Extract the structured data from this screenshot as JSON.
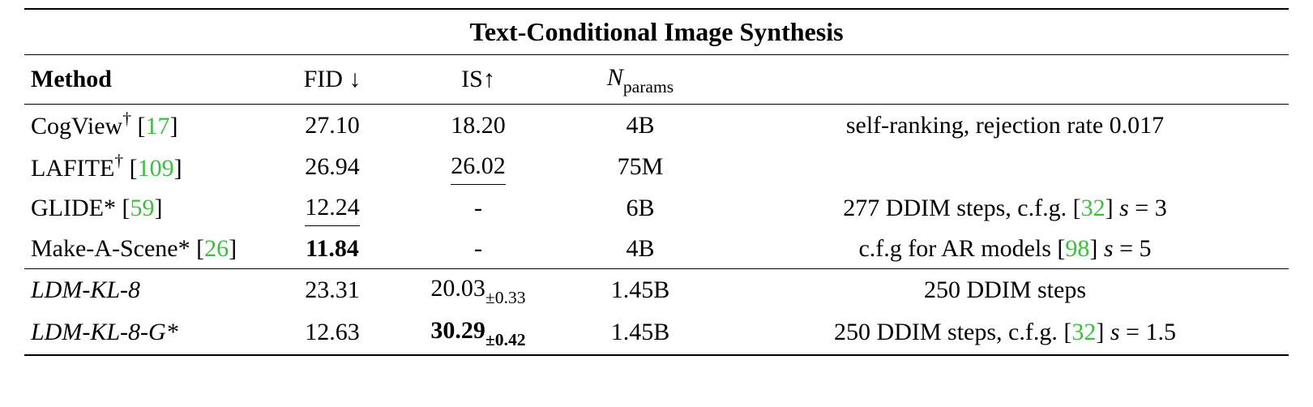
{
  "title": "Text-Conditional Image Synthesis",
  "headers": {
    "method": "Method",
    "fid_label": "FID",
    "fid_arrow": "↓",
    "is_label": "IS",
    "is_arrow": "↑",
    "nparams_symbol": "N",
    "nparams_sub": "params"
  },
  "rows": {
    "r0": {
      "method": "CogView",
      "method_marker": "†",
      "cite": "17",
      "fid": "27.10",
      "is": "18.20",
      "nparams": "4B",
      "note": "self-ranking, rejection rate 0.017"
    },
    "r1": {
      "method": "LAFITE",
      "method_marker": "†",
      "cite": "109",
      "fid": "26.94",
      "is": "26.02",
      "nparams": "75M",
      "note": ""
    },
    "r2": {
      "method": "GLIDE",
      "method_marker": "*",
      "cite": "59",
      "fid": "12.24",
      "is": "-",
      "nparams": "6B",
      "note_a": "277 DDIM steps, c.f.g. [",
      "note_cite": "32",
      "note_b": "] ",
      "note_s": "s",
      "note_eq": " = 3"
    },
    "r3": {
      "method": "Make-A-Scene",
      "method_marker": "*",
      "cite": "26",
      "fid": "11.84",
      "is": "-",
      "nparams": "4B",
      "note_a": "c.f.g for AR models [",
      "note_cite": "98",
      "note_b": "] ",
      "note_s": "s",
      "note_eq": " = 5"
    },
    "r4": {
      "method": "LDM-KL-8",
      "fid": "23.31",
      "is": "20.03",
      "is_pm": "±0.33",
      "nparams": "1.45B",
      "note": "250 DDIM steps"
    },
    "r5": {
      "method": "LDM-KL-8-G",
      "method_marker": "*",
      "fid": "12.63",
      "is": "30.29",
      "is_pm": "±0.42",
      "nparams": "1.45B",
      "note_a": "250 DDIM steps, c.f.g. [",
      "note_cite": "32",
      "note_b": "] ",
      "note_s": "s",
      "note_eq": " = 1.5"
    }
  },
  "chart_data": {
    "type": "table",
    "title": "Text-Conditional Image Synthesis",
    "columns": [
      "Method",
      "FID↓",
      "IS↑",
      "N_params",
      "Note"
    ],
    "rows": [
      {
        "method": "CogView† [17]",
        "fid": 27.1,
        "is": 18.2,
        "n_params": "4B",
        "note": "self-ranking, rejection rate 0.017"
      },
      {
        "method": "LAFITE† [109]",
        "fid": 26.94,
        "is": 26.02,
        "n_params": "75M",
        "note": ""
      },
      {
        "method": "GLIDE* [59]",
        "fid": 12.24,
        "is": null,
        "n_params": "6B",
        "note": "277 DDIM steps, c.f.g. [32] s = 3"
      },
      {
        "method": "Make-A-Scene* [26]",
        "fid": 11.84,
        "is": null,
        "n_params": "4B",
        "note": "c.f.g for AR models [98] s = 5"
      },
      {
        "method": "LDM-KL-8",
        "fid": 23.31,
        "is": 20.03,
        "is_pm": 0.33,
        "n_params": "1.45B",
        "note": "250 DDIM steps"
      },
      {
        "method": "LDM-KL-8-G*",
        "fid": 12.63,
        "is": 30.29,
        "is_pm": 0.42,
        "n_params": "1.45B",
        "note": "250 DDIM steps, c.f.g. [32] s = 1.5"
      }
    ],
    "highlights": {
      "best_fid": "Make-A-Scene* [26]",
      "second_best_fid": "GLIDE* [59]",
      "best_is": "LDM-KL-8-G*",
      "second_best_is": "LAFITE† [109]"
    }
  }
}
